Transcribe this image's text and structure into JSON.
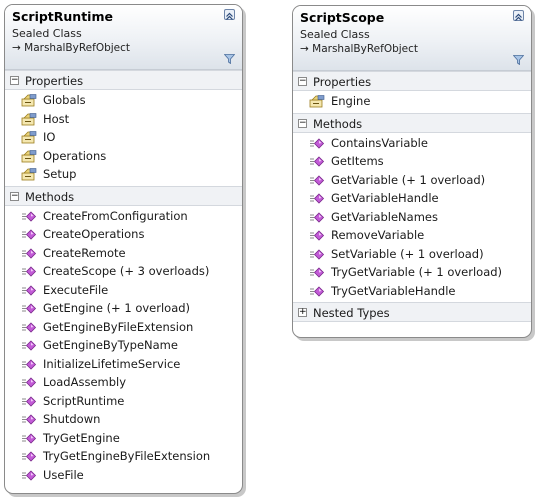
{
  "classes": [
    {
      "name": "ScriptRuntime",
      "stereotype": "Sealed Class",
      "base": "→ MarshalByRefObject",
      "collapse_glyph": "»",
      "properties_label": "Properties",
      "properties": [
        "Globals",
        "Host",
        "IO",
        "Operations",
        "Setup"
      ],
      "methods_label": "Methods",
      "methods": [
        "CreateFromConfiguration",
        "CreateOperations",
        "CreateRemote",
        "CreateScope (+ 3 overloads)",
        "ExecuteFile",
        "GetEngine (+ 1 overload)",
        "GetEngineByFileExtension",
        "GetEngineByTypeName",
        "InitializeLifetimeService",
        "LoadAssembly",
        "ScriptRuntime",
        "Shutdown",
        "TryGetEngine",
        "TryGetEngineByFileExtension",
        "UseFile"
      ]
    },
    {
      "name": "ScriptScope",
      "stereotype": "Sealed Class",
      "base": "→ MarshalByRefObject",
      "collapse_glyph": "»",
      "properties_label": "Properties",
      "properties": [
        "Engine"
      ],
      "methods_label": "Methods",
      "methods": [
        "ContainsVariable",
        "GetItems",
        "GetVariable (+ 1 overload)",
        "GetVariableHandle",
        "GetVariableNames",
        "RemoveVariable",
        "SetVariable (+ 1 overload)",
        "TryGetVariable (+ 1 overload)",
        "TryGetVariableHandle"
      ],
      "nested_label": "Nested Types"
    }
  ],
  "toggles": {
    "expanded": "−",
    "collapsed": "+"
  },
  "icons": {
    "property": "property-icon",
    "method": "method-icon",
    "filter": "filter-icon",
    "collapse": "collapse-chevron-icon"
  },
  "colors": {
    "method_icon": "#b04fc6",
    "property_icon": "#c9a227",
    "header_gradient_end": "#dde3ea"
  }
}
